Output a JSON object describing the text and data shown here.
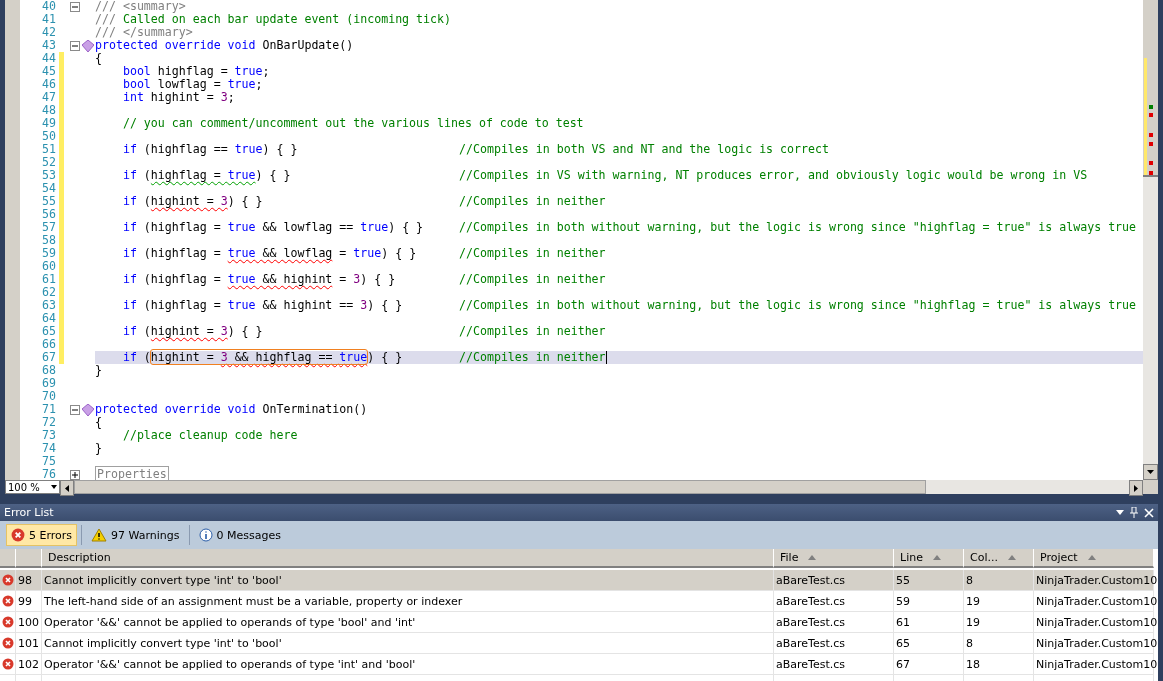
{
  "editor": {
    "lines": [
      {
        "number": "40",
        "changed": false,
        "current": false,
        "folded": false,
        "segments": [
          {
            "kind": "doc",
            "text": "/// <summary>"
          }
        ]
      },
      {
        "number": "41",
        "changed": false,
        "current": false,
        "segments": [
          {
            "kind": "doc",
            "text": "/// "
          },
          {
            "kind": "comment",
            "text": "Called on each bar update event (incoming tick)"
          }
        ]
      },
      {
        "number": "42",
        "changed": false,
        "current": false,
        "segments": [
          {
            "kind": "doc",
            "text": "/// </summary>"
          }
        ]
      },
      {
        "number": "43",
        "changed": false,
        "current": false,
        "folded": false,
        "member": true,
        "segments": [
          {
            "kind": "keyword",
            "text": "protected override void "
          },
          {
            "kind": "plain",
            "text": "OnBarUpdate()"
          }
        ]
      },
      {
        "number": "44",
        "changed": true,
        "current": false,
        "segments": [
          {
            "kind": "plain",
            "text": "{"
          }
        ]
      },
      {
        "number": "45",
        "changed": true,
        "current": false,
        "segments": [
          {
            "kind": "keyword",
            "text": "    bool"
          },
          {
            "kind": "plain",
            "text": " highflag = "
          },
          {
            "kind": "keyword",
            "text": "true"
          },
          {
            "kind": "plain",
            "text": ";"
          }
        ]
      },
      {
        "number": "46",
        "changed": true,
        "current": false,
        "segments": [
          {
            "kind": "keyword",
            "text": "    bool"
          },
          {
            "kind": "plain",
            "text": " lowflag = "
          },
          {
            "kind": "keyword",
            "text": "true"
          },
          {
            "kind": "plain",
            "text": ";"
          }
        ]
      },
      {
        "number": "47",
        "changed": true,
        "current": false,
        "segments": [
          {
            "kind": "keyword",
            "text": "    int"
          },
          {
            "kind": "plain",
            "text": " highint = "
          },
          {
            "kind": "number",
            "text": "3"
          },
          {
            "kind": "plain",
            "text": ";"
          }
        ]
      },
      {
        "number": "48",
        "changed": true,
        "current": false
      },
      {
        "number": "49",
        "changed": true,
        "current": false,
        "segments": [
          {
            "kind": "comment",
            "text": "    // you can comment/uncomment out the various lines of code to test"
          }
        ]
      },
      {
        "number": "50",
        "changed": true,
        "current": false
      },
      {
        "number": "51",
        "changed": true,
        "current": false,
        "segments": [
          {
            "kind": "keyword",
            "text": "    if"
          },
          {
            "kind": "plain",
            "text": " (highflag == "
          },
          {
            "kind": "keyword",
            "text": "true"
          },
          {
            "kind": "plain",
            "text": ") { }"
          }
        ],
        "comment": "//Compiles in both VS and NT and the logic is correct"
      },
      {
        "number": "52",
        "changed": true,
        "current": false
      },
      {
        "number": "53",
        "changed": true,
        "current": false,
        "segments": [
          {
            "kind": "keyword",
            "text": "    if"
          },
          {
            "kind": "plain",
            "text": " ("
          },
          {
            "kind": "plain",
            "text": "highflag = ",
            "warning": true
          },
          {
            "kind": "keyword",
            "text": "true",
            "warning": true
          },
          {
            "kind": "plain",
            "text": ") { }"
          }
        ],
        "comment": "//Compiles in VS with warning, NT produces error, and obviously logic would be wrong in VS"
      },
      {
        "number": "54",
        "changed": true,
        "current": false
      },
      {
        "number": "55",
        "changed": true,
        "current": false,
        "segments": [
          {
            "kind": "keyword",
            "text": "    if"
          },
          {
            "kind": "plain",
            "text": " ("
          },
          {
            "kind": "plain",
            "text": "highint = ",
            "error": true
          },
          {
            "kind": "number",
            "text": "3",
            "error": true
          },
          {
            "kind": "plain",
            "text": ") { }"
          }
        ],
        "comment": "//Compiles in neither"
      },
      {
        "number": "56",
        "changed": true,
        "current": false
      },
      {
        "number": "57",
        "changed": true,
        "current": false,
        "segments": [
          {
            "kind": "keyword",
            "text": "    if"
          },
          {
            "kind": "plain",
            "text": " (highflag = "
          },
          {
            "kind": "keyword",
            "text": "true"
          },
          {
            "kind": "plain",
            "text": " && lowflag == "
          },
          {
            "kind": "keyword",
            "text": "true"
          },
          {
            "kind": "plain",
            "text": ") { }"
          }
        ],
        "comment": "//Compiles in both without warning, but the logic is wrong since \"highflag = true\" is always true"
      },
      {
        "number": "58",
        "changed": true,
        "current": false
      },
      {
        "number": "59",
        "changed": true,
        "current": false,
        "segments": [
          {
            "kind": "keyword",
            "text": "    if"
          },
          {
            "kind": "plain",
            "text": " (highflag = "
          },
          {
            "kind": "keyword",
            "text": "true",
            "error": true
          },
          {
            "kind": "plain",
            "text": " && lowflag",
            "error": true
          },
          {
            "kind": "plain",
            "text": " = "
          },
          {
            "kind": "keyword",
            "text": "true"
          },
          {
            "kind": "plain",
            "text": ") { }"
          }
        ],
        "comment": "//Compiles in neither"
      },
      {
        "number": "60",
        "changed": true,
        "current": false
      },
      {
        "number": "61",
        "changed": true,
        "current": false,
        "segments": [
          {
            "kind": "keyword",
            "text": "    if"
          },
          {
            "kind": "plain",
            "text": " (highflag = "
          },
          {
            "kind": "keyword",
            "text": "true",
            "error": true
          },
          {
            "kind": "plain",
            "text": " && highint",
            "error": true
          },
          {
            "kind": "plain",
            "text": " = "
          },
          {
            "kind": "number",
            "text": "3"
          },
          {
            "kind": "plain",
            "text": ") { }"
          }
        ],
        "comment": "//Compiles in neither"
      },
      {
        "number": "62",
        "changed": true,
        "current": false
      },
      {
        "number": "63",
        "changed": true,
        "current": false,
        "segments": [
          {
            "kind": "keyword",
            "text": "    if"
          },
          {
            "kind": "plain",
            "text": " (highflag = "
          },
          {
            "kind": "keyword",
            "text": "true"
          },
          {
            "kind": "plain",
            "text": " && highint == "
          },
          {
            "kind": "number",
            "text": "3"
          },
          {
            "kind": "plain",
            "text": ") { }"
          }
        ],
        "comment": "//Compiles in both without warning, but the logic is wrong since \"highflag = true\" is always true"
      },
      {
        "number": "64",
        "changed": true,
        "current": false
      },
      {
        "number": "65",
        "changed": true,
        "current": false,
        "segments": [
          {
            "kind": "keyword",
            "text": "    if"
          },
          {
            "kind": "plain",
            "text": " ("
          },
          {
            "kind": "plain",
            "text": "highint = ",
            "error": true
          },
          {
            "kind": "number",
            "text": "3",
            "error": true
          },
          {
            "kind": "plain",
            "text": ") { }"
          }
        ],
        "comment": "//Compiles in neither"
      },
      {
        "number": "66",
        "changed": true,
        "current": false
      },
      {
        "number": "67",
        "changed": true,
        "current": true,
        "caret": true,
        "segments": [
          {
            "kind": "keyword",
            "text": "    if"
          },
          {
            "kind": "plain",
            "text": " ("
          },
          {
            "kind": "plain",
            "text": "highint = ",
            "boxed": true
          },
          {
            "kind": "number",
            "text": "3",
            "boxed": true,
            "error": true
          },
          {
            "kind": "plain",
            "text": " && highflag == ",
            "boxed": true,
            "error": true
          },
          {
            "kind": "keyword",
            "text": "true",
            "boxed": true,
            "error": true
          },
          {
            "kind": "plain",
            "text": ") { }"
          }
        ],
        "comment": "//Compiles in neither"
      },
      {
        "number": "68",
        "changed": false,
        "current": false,
        "segments": [
          {
            "kind": "plain",
            "text": "}"
          }
        ]
      },
      {
        "number": "69",
        "changed": false,
        "current": false
      },
      {
        "number": "70",
        "changed": false,
        "current": false
      },
      {
        "number": "71",
        "changed": false,
        "current": false,
        "folded": false,
        "member": true,
        "segments": [
          {
            "kind": "keyword",
            "text": "protected override void "
          },
          {
            "kind": "plain",
            "text": "OnTermination()"
          }
        ]
      },
      {
        "number": "72",
        "changed": false,
        "current": false,
        "segments": [
          {
            "kind": "plain",
            "text": "{"
          }
        ]
      },
      {
        "number": "73",
        "changed": false,
        "current": false,
        "segments": [
          {
            "kind": "comment",
            "text": "    //place cleanup code here"
          }
        ]
      },
      {
        "number": "74",
        "changed": false,
        "current": false,
        "segments": [
          {
            "kind": "plain",
            "text": "}"
          }
        ]
      },
      {
        "number": "75",
        "changed": false,
        "current": false
      },
      {
        "number": "76",
        "changed": false,
        "current": false,
        "folded": true,
        "segments": [
          {
            "kind": "region",
            "text": "Properties"
          }
        ]
      }
    ],
    "zoom": "100 %"
  },
  "error_list": {
    "title": "Error List",
    "filters": [
      {
        "kind": "error",
        "label": "5 Errors",
        "selected": true
      },
      {
        "kind": "warning",
        "label": "97 Warnings",
        "selected": false
      },
      {
        "kind": "info",
        "label": "0 Messages",
        "selected": false
      }
    ],
    "columns": [
      {
        "label": "Description",
        "sorted": false
      },
      {
        "label": "File",
        "sorted": true
      },
      {
        "label": "Line",
        "sorted": true
      },
      {
        "label": "Col...",
        "sorted": true
      },
      {
        "label": "Project",
        "sorted": true
      }
    ],
    "rows": [
      {
        "number": "98",
        "description": "Cannot implicitly convert type 'int' to 'bool'",
        "file": "aBareTest.cs",
        "line": "55",
        "column": "8",
        "project": "NinjaTrader.Custom10",
        "selected": true
      },
      {
        "number": "99",
        "description": "The left-hand side of an assignment must be a variable, property or indexer",
        "file": "aBareTest.cs",
        "line": "59",
        "column": "19",
        "project": "NinjaTrader.Custom10",
        "selected": false
      },
      {
        "number": "100",
        "description": "Operator '&&' cannot be applied to operands of type 'bool' and 'int'",
        "file": "aBareTest.cs",
        "line": "61",
        "column": "19",
        "project": "NinjaTrader.Custom10",
        "selected": false
      },
      {
        "number": "101",
        "description": "Cannot implicitly convert type 'int' to 'bool'",
        "file": "aBareTest.cs",
        "line": "65",
        "column": "8",
        "project": "NinjaTrader.Custom10",
        "selected": false
      },
      {
        "number": "102",
        "description": "Operator '&&' cannot be applied to operands of type 'int' and 'bool'",
        "file": "aBareTest.cs",
        "line": "67",
        "column": "18",
        "project": "NinjaTrader.Custom10",
        "selected": false
      }
    ]
  }
}
